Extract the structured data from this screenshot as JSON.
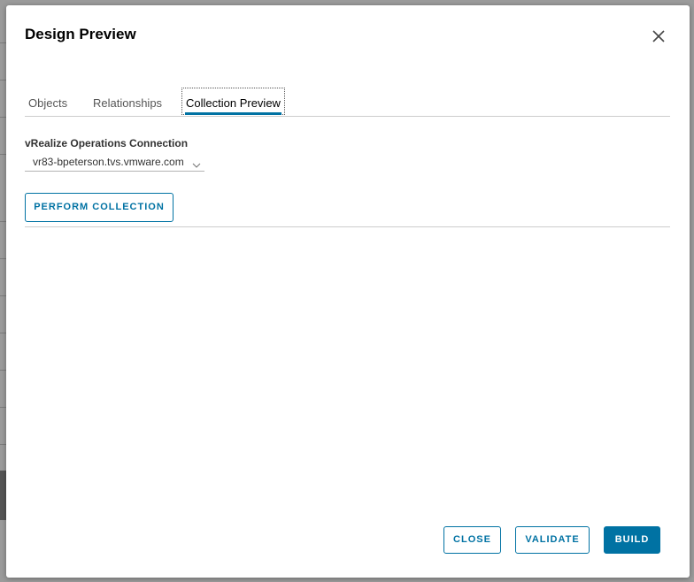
{
  "modal": {
    "title": "Design Preview",
    "close_icon": "close-icon"
  },
  "tabs": [
    {
      "label": "Objects",
      "selected": false
    },
    {
      "label": "Relationships",
      "selected": false
    },
    {
      "label": "Collection Preview",
      "selected": true
    }
  ],
  "connection": {
    "label": "vRealize Operations Connection",
    "selected_value": "vr83-bpeterson.tvs.vmware.com",
    "caret_icon": "chevron-down-icon"
  },
  "actions": {
    "perform_collection": "PERFORM COLLECTION"
  },
  "footer": {
    "close_label": "CLOSE",
    "validate_label": "VALIDATE",
    "build_label": "BUILD"
  },
  "colors": {
    "accent": "#0072a3",
    "tab_underline": "#0072a3",
    "divider": "#cccccc"
  }
}
